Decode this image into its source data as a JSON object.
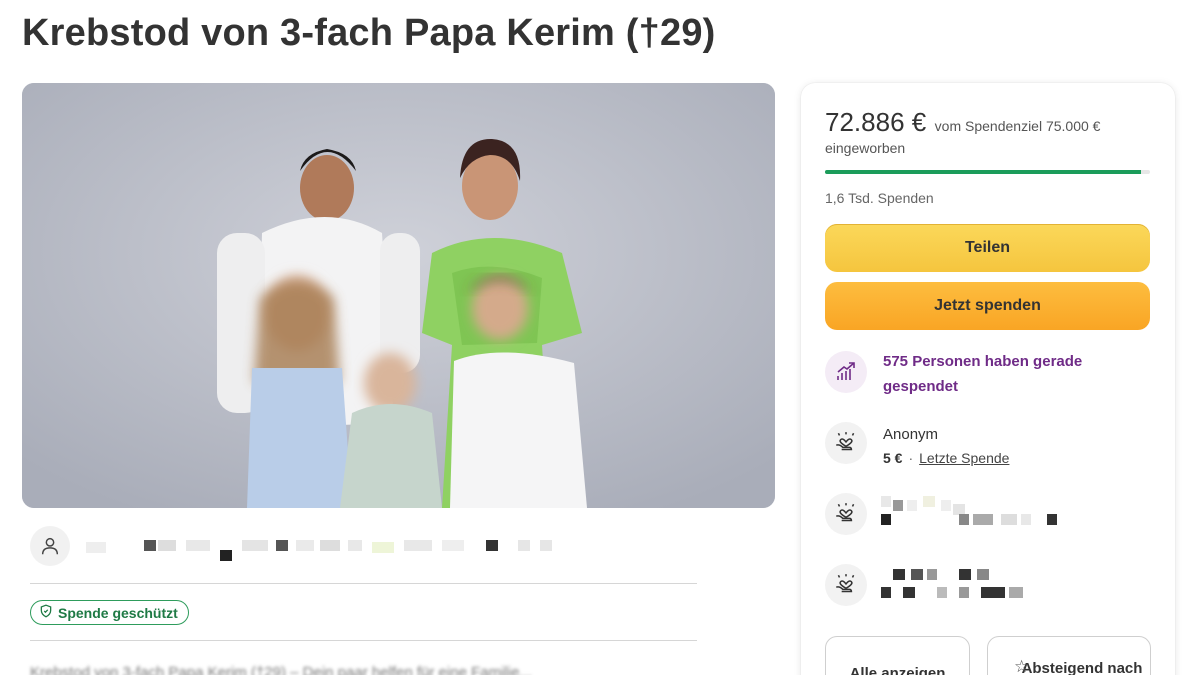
{
  "page": {
    "title": "Krebstod von 3-fach Papa Kerim (†29)"
  },
  "organizer": {
    "icon": "user-icon"
  },
  "badge": {
    "label": "Spende geschützt",
    "icon": "shield-icon",
    "color": "#2e9c5c"
  },
  "description": {
    "snippet": "Krebstod von 3-fach Papa Kerim (†29) – Dein paar helfen für eine Familie..."
  },
  "donation": {
    "amount": "72.886 €",
    "goal_text": "vom Spendenziel 75.000 €",
    "raised_label": "eingeworben",
    "progress_fraction": 0.972,
    "count": "1,6 Tsd. Spenden",
    "share_label": "Teilen",
    "donate_label": "Jetzt spenden",
    "accent_color": "#1b9c5a"
  },
  "activity": {
    "recent_text": "575 Personen haben gerade gespendet",
    "icon": "trend-up-icon",
    "color": "#6f2b87"
  },
  "donors": [
    {
      "name": "Anonym",
      "amount": "5 €",
      "tag": "Letzte Spende",
      "icon": "heart-hand-icon"
    }
  ],
  "actions": {
    "show_all_label": "Alle anzeigen",
    "sort_label": "Absteigend nach",
    "sort_icon": "star-icon"
  }
}
